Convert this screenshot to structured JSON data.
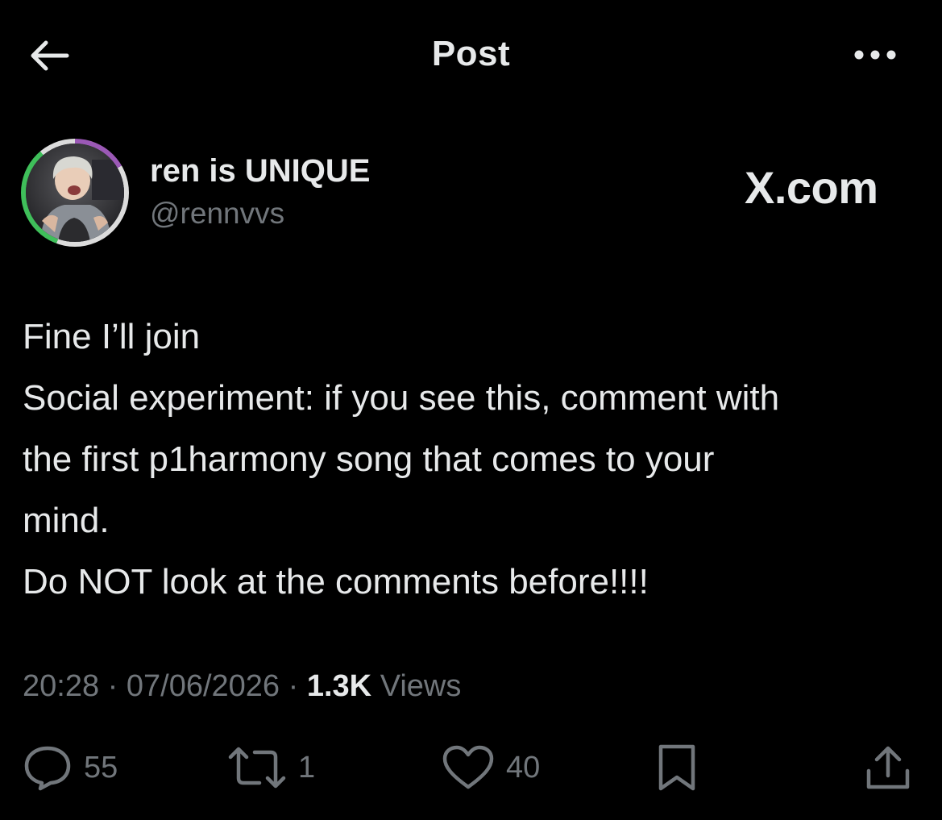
{
  "header": {
    "title": "Post"
  },
  "author": {
    "display_name": "ren is UNIQUE",
    "handle": "@rennvvs"
  },
  "watermark": "X.com",
  "post": {
    "lines": [
      "Fine I’ll join",
      "Social experiment: if you see this, comment with",
      "the first p1harmony song that comes to your",
      "mind.",
      "Do NOT look at the comments before!!!!"
    ]
  },
  "meta": {
    "time": "20:28",
    "separator": "·",
    "date": "07/06/2026",
    "views_count": "1.3K",
    "views_label": "Views"
  },
  "actions": {
    "replies": "55",
    "reposts": "1",
    "likes": "40"
  },
  "icons": {
    "back": "arrow-left-icon",
    "more": "more-dots-icon",
    "reply": "reply-bubble-icon",
    "repost": "repost-icon",
    "like": "heart-icon",
    "bookmark": "bookmark-icon",
    "share": "share-icon"
  },
  "colors": {
    "background": "#000000",
    "text": "#e7e9ea",
    "muted": "#71767b"
  }
}
